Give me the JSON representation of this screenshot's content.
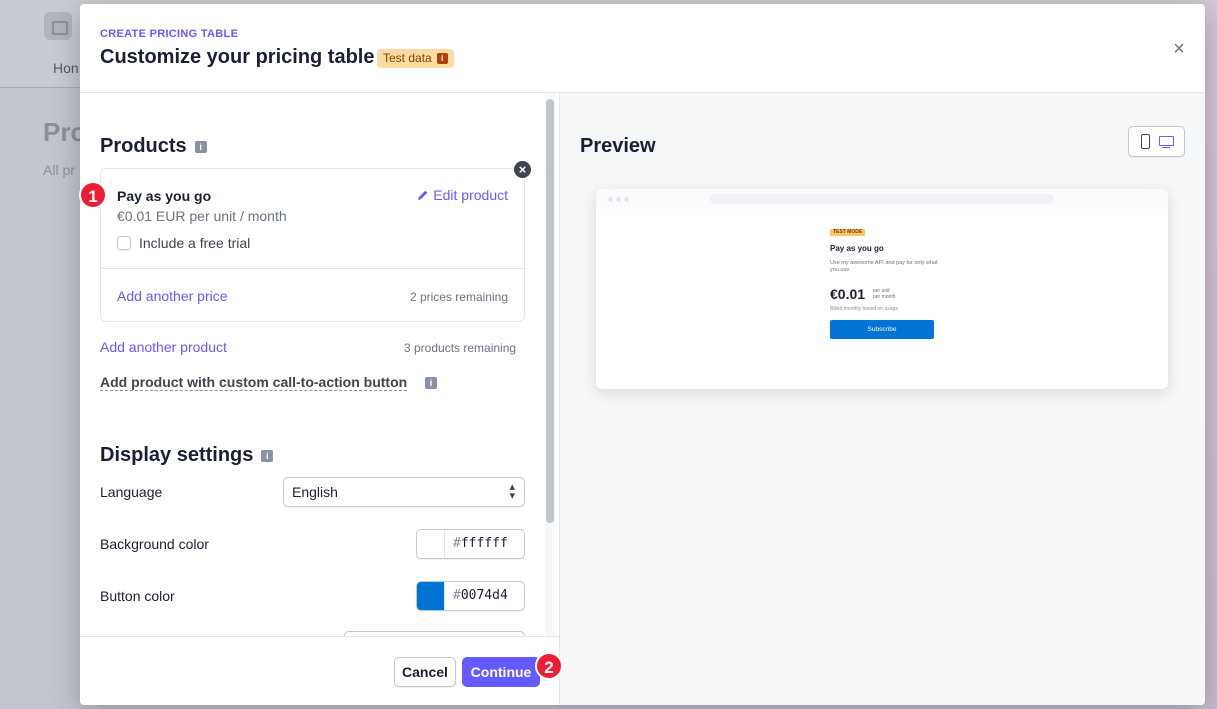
{
  "background": {
    "nav_item": "Hon",
    "page_title": "Pro",
    "page_subtitle": "All pr"
  },
  "modal": {
    "eyebrow": "CREATE PRICING TABLE",
    "title": "Customize your pricing table",
    "test_badge": "Test data",
    "close_icon": "×"
  },
  "products": {
    "section_title": "Products",
    "items": [
      {
        "name": "Pay as you go",
        "price": "€0.01 EUR per unit / month",
        "edit_label": "Edit product",
        "trial_label": "Include a free trial",
        "trial_checked": false,
        "add_price_label": "Add another price",
        "prices_remaining": "2 prices remaining"
      }
    ],
    "add_product_label": "Add another product",
    "products_remaining": "3 products remaining",
    "custom_cta_label": "Add product with custom call-to-action button"
  },
  "display_settings": {
    "section_title": "Display settings",
    "language_label": "Language",
    "language_value": "English",
    "background_color_label": "Background color",
    "background_color_hex": "ffffff",
    "background_color": "#ffffff",
    "button_color_label": "Button color",
    "button_color_hex": "0074d4",
    "button_color": "#0074d4"
  },
  "footer": {
    "cancel_label": "Cancel",
    "continue_label": "Continue"
  },
  "step_badges": [
    "1",
    "2"
  ],
  "preview": {
    "title": "Preview",
    "devices": [
      "mobile-icon",
      "desktop-icon"
    ],
    "selected_device": "desktop",
    "card": {
      "badge": "TEST MODE",
      "name": "Pay as you go",
      "description": "Use my awesome API and pay for only what you use.",
      "price": "€0.01",
      "unit_line1": "per unit",
      "unit_line2": "per month",
      "billing_note": "Billed monthly based on usage",
      "subscribe_label": "Subscribe"
    }
  },
  "colors": {
    "accent": "#635bff",
    "step_badge": "#ee1d36",
    "test_badge_bg": "#fcdca3"
  }
}
